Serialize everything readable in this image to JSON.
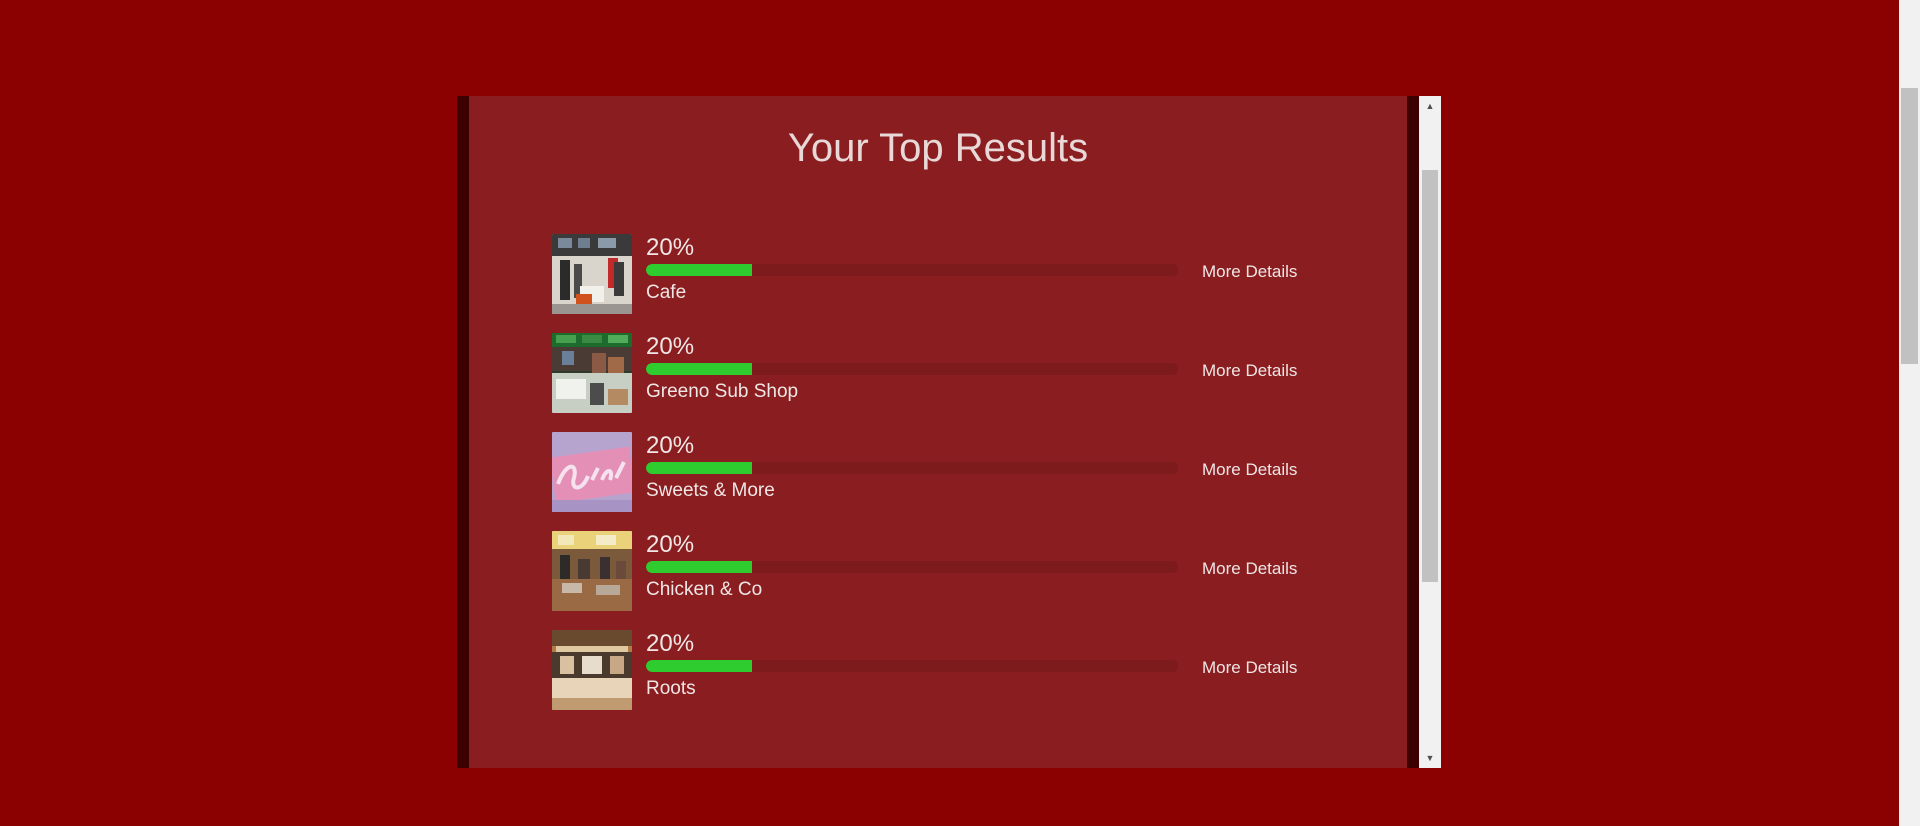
{
  "modal": {
    "title": "Your Top Results"
  },
  "results": [
    {
      "percent_label": "20%",
      "percent": 20,
      "name": "Cafe",
      "link_label": "More Details",
      "image": "cafe-photo"
    },
    {
      "percent_label": "20%",
      "percent": 20,
      "name": "Greeno Sub Shop",
      "link_label": "More Details",
      "image": "sub-shop-photo"
    },
    {
      "percent_label": "20%",
      "percent": 20,
      "name": "Sweets & More",
      "link_label": "More Details",
      "image": "sweets-sign-photo"
    },
    {
      "percent_label": "20%",
      "percent": 20,
      "name": "Chicken & Co",
      "link_label": "More Details",
      "image": "dining-hall-photo"
    },
    {
      "percent_label": "20%",
      "percent": 20,
      "name": "Roots",
      "link_label": "More Details",
      "image": "food-counter-photo"
    }
  ],
  "scrollbar": {
    "up_icon": "arrow-up-icon",
    "down_icon": "arrow-down-icon"
  },
  "colors": {
    "background": "#8b0000",
    "modal": "#891d1f",
    "bar_fill": "#2ecc2e",
    "bar_track": "#7d1a1c",
    "text": "#f0e6e6"
  }
}
